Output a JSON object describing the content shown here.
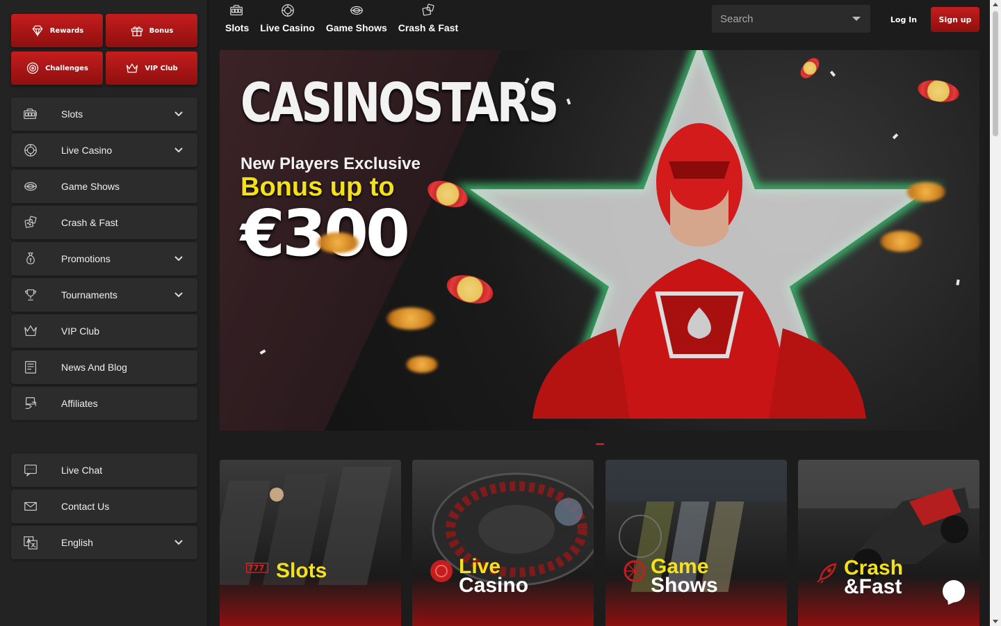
{
  "sidebar": {
    "top_buttons": [
      {
        "label": "Rewards",
        "icon": "diamond-icon"
      },
      {
        "label": "Bonus",
        "icon": "gift-icon"
      },
      {
        "label": "Challenges",
        "icon": "target-icon"
      },
      {
        "label": "VIP Club",
        "icon": "crown-icon"
      }
    ],
    "nav": [
      {
        "label": "Slots",
        "icon": "slot-machine-icon",
        "expandable": true
      },
      {
        "label": "Live Casino",
        "icon": "roulette-chip-icon",
        "expandable": true
      },
      {
        "label": "Game Shows",
        "icon": "wheel-icon",
        "expandable": false
      },
      {
        "label": "Crash & Fast",
        "icon": "dice-icon",
        "expandable": false
      },
      {
        "label": "Promotions",
        "icon": "money-bag-icon",
        "expandable": true
      },
      {
        "label": "Tournaments",
        "icon": "trophy-icon",
        "expandable": true
      },
      {
        "label": "VIP Club",
        "icon": "crown-icon",
        "expandable": false
      },
      {
        "label": "News And Blog",
        "icon": "newspaper-icon",
        "expandable": false
      },
      {
        "label": "Affiliates",
        "icon": "handshake-icon",
        "expandable": false
      }
    ],
    "support": [
      {
        "label": "Live Chat",
        "icon": "chat-icon",
        "expandable": false
      },
      {
        "label": "Contact Us",
        "icon": "envelope-icon",
        "expandable": false
      },
      {
        "label": "English",
        "icon": "translate-icon",
        "expandable": true
      }
    ]
  },
  "header": {
    "tabs": [
      {
        "label": "Slots",
        "icon": "slot-machine-icon"
      },
      {
        "label": "Live Casino",
        "icon": "roulette-chip-icon"
      },
      {
        "label": "Game Shows",
        "icon": "wheel-icon"
      },
      {
        "label": "Crash & Fast",
        "icon": "dice-icon"
      }
    ],
    "search_placeholder": "Search",
    "login_label": "Log In",
    "signup_label": "Sign up"
  },
  "hero": {
    "brand": "CASINOSTARS",
    "line1": "New Players Exclusive",
    "line2": "Bonus up to",
    "amount": "€300"
  },
  "categories": [
    {
      "line1": "Slots",
      "line2": "",
      "icon": "777-icon"
    },
    {
      "line1": "Live",
      "line2": "Casino",
      "icon": "roulette-chip-icon"
    },
    {
      "line1": "Game",
      "line2": "Shows",
      "icon": "wheel-icon"
    },
    {
      "line1": "Crash",
      "line2": "&Fast",
      "icon": "rocket-icon"
    }
  ],
  "colors": {
    "accent_red": "#c41d1d",
    "accent_yellow": "#f5e11a",
    "background": "#1c1c1c",
    "panel": "#2c2c2c"
  }
}
